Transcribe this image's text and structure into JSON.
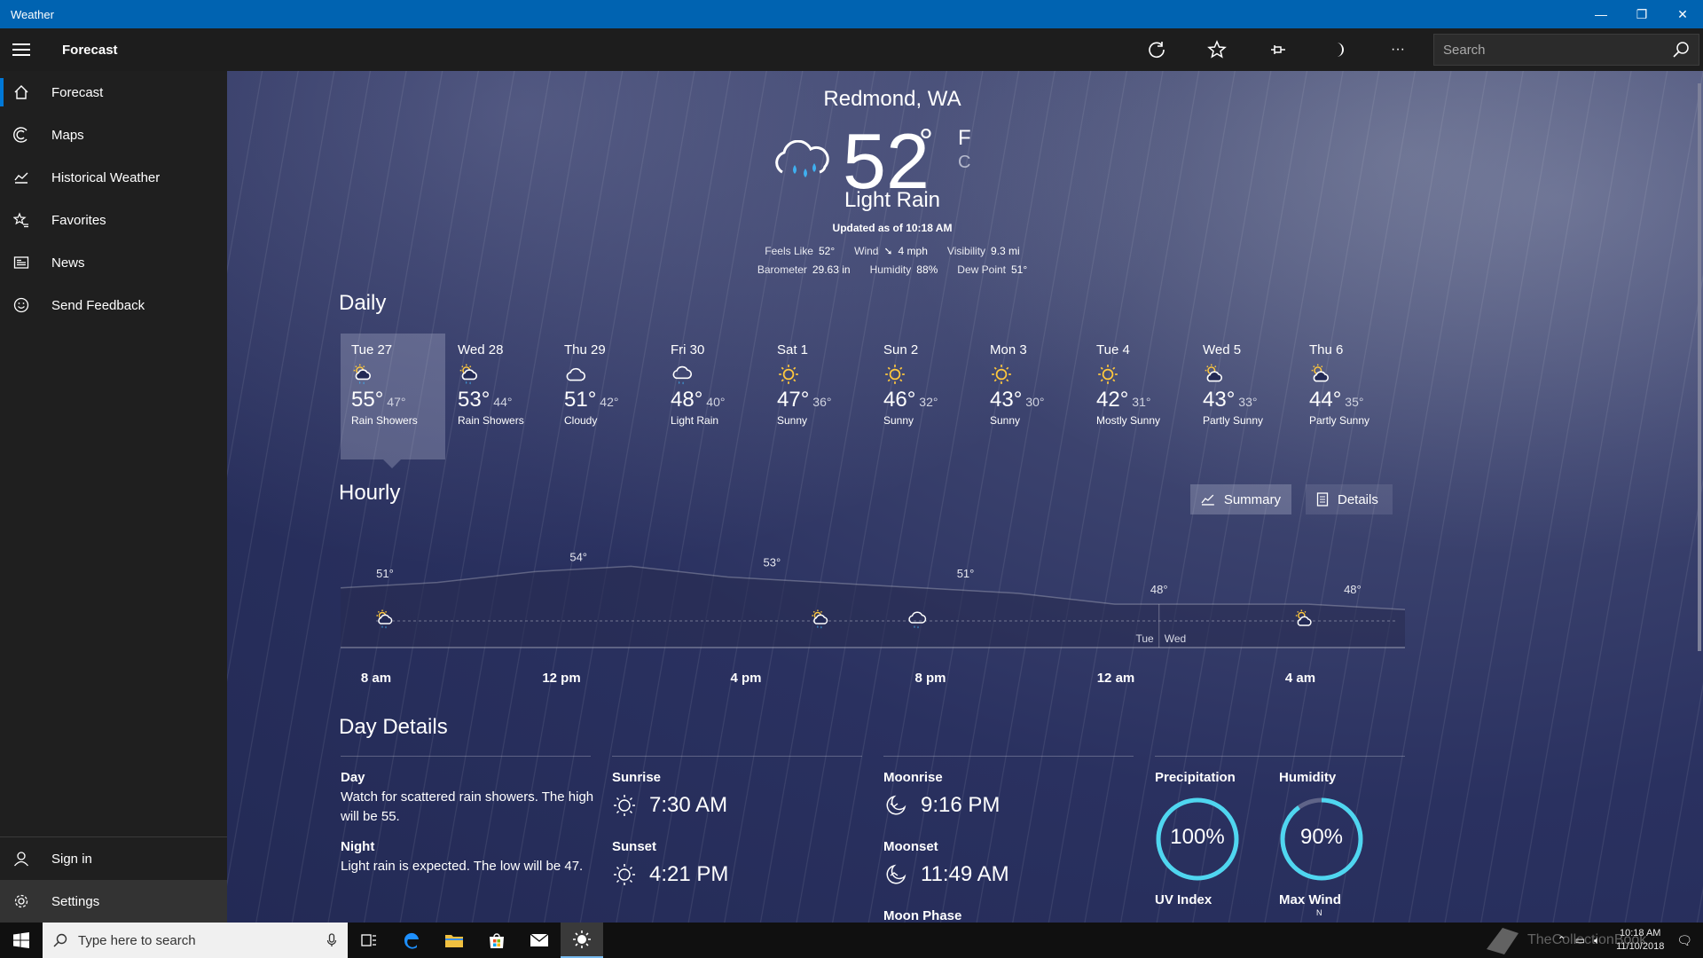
{
  "window": {
    "title": "Weather",
    "minimize": "—",
    "maximize": "❐",
    "close": "✕"
  },
  "appbar": {
    "page_title": "Forecast",
    "search_placeholder": "Search",
    "more": "···"
  },
  "sidebar": {
    "items": [
      {
        "label": "Forecast",
        "icon": "home-icon"
      },
      {
        "label": "Maps",
        "icon": "maps-icon"
      },
      {
        "label": "Historical Weather",
        "icon": "chart-icon"
      },
      {
        "label": "Favorites",
        "icon": "star-list-icon"
      },
      {
        "label": "News",
        "icon": "news-icon"
      },
      {
        "label": "Send Feedback",
        "icon": "smiley-icon"
      }
    ],
    "bottom": [
      {
        "label": "Sign in",
        "icon": "person-icon"
      },
      {
        "label": "Settings",
        "icon": "gear-icon"
      }
    ]
  },
  "current": {
    "location": "Redmond, WA",
    "temp": "52",
    "degree": "°",
    "unit_f": "F",
    "unit_c": "C",
    "condition": "Light Rain",
    "updated": "Updated as of 10:18 AM",
    "feels_like_label": "Feels Like",
    "feels_like": "52°",
    "wind_label": "Wind",
    "wind": "4 mph",
    "visibility_label": "Visibility",
    "visibility": "9.3 mi",
    "barometer_label": "Barometer",
    "barometer": "29.63 in",
    "humidity_label": "Humidity",
    "humidity": "88%",
    "dew_label": "Dew Point",
    "dew": "51°"
  },
  "daily": {
    "title": "Daily",
    "days": [
      {
        "name": "Tue 27",
        "hi": "55°",
        "lo": "47°",
        "cond": "Rain Showers",
        "icon": "rain-sun-icon"
      },
      {
        "name": "Wed 28",
        "hi": "53°",
        "lo": "44°",
        "cond": "Rain Showers",
        "icon": "rain-sun-icon"
      },
      {
        "name": "Thu 29",
        "hi": "51°",
        "lo": "42°",
        "cond": "Cloudy",
        "icon": "cloud-icon"
      },
      {
        "name": "Fri 30",
        "hi": "48°",
        "lo": "40°",
        "cond": "Light Rain",
        "icon": "rain-icon"
      },
      {
        "name": "Sat 1",
        "hi": "47°",
        "lo": "36°",
        "cond": "Sunny",
        "icon": "sun-icon"
      },
      {
        "name": "Sun 2",
        "hi": "46°",
        "lo": "32°",
        "cond": "Sunny",
        "icon": "sun-icon"
      },
      {
        "name": "Mon 3",
        "hi": "43°",
        "lo": "30°",
        "cond": "Sunny",
        "icon": "sun-icon"
      },
      {
        "name": "Tue 4",
        "hi": "42°",
        "lo": "31°",
        "cond": "Mostly Sunny",
        "icon": "sun-icon"
      },
      {
        "name": "Wed 5",
        "hi": "43°",
        "lo": "33°",
        "cond": "Partly Sunny",
        "icon": "partly-sunny-icon"
      },
      {
        "name": "Thu 6",
        "hi": "44°",
        "lo": "35°",
        "cond": "Partly Sunny",
        "icon": "partly-sunny-icon"
      }
    ]
  },
  "hourly": {
    "title": "Hourly",
    "summary_label": "Summary",
    "details_label": "Details",
    "labels": [
      "8 am",
      "12 pm",
      "4 pm",
      "8 pm",
      "12 am",
      "4 am"
    ],
    "day_divider": [
      "Tue",
      "Wed"
    ]
  },
  "chart_data": {
    "type": "area",
    "x": [
      "8 am",
      "10 am",
      "12 pm",
      "2 pm",
      "4 pm",
      "6 pm",
      "8 pm",
      "10 pm",
      "12 am",
      "2 am",
      "4 am",
      "6 am"
    ],
    "values": [
      51,
      52,
      54,
      55,
      53,
      52,
      51,
      50,
      48,
      48,
      48,
      47
    ],
    "point_labels": [
      "51°",
      "54°",
      "53°",
      "51°",
      "48°",
      "48°"
    ],
    "point_label_x": [
      "8 am",
      "12 pm",
      "4 pm",
      "8 pm",
      "12 am",
      "4 am"
    ],
    "point_label_values": [
      51,
      54,
      53,
      51,
      48,
      48
    ],
    "icons": [
      {
        "x": "8 am",
        "icon": "rain-sun-icon"
      },
      {
        "x": "5 pm",
        "icon": "rain-sun-icon"
      },
      {
        "x": "7 pm",
        "icon": "rain-icon"
      },
      {
        "x": "3 am",
        "icon": "partly-sunny-icon"
      }
    ]
  },
  "day_details": {
    "title": "Day Details",
    "day_label": "Day",
    "day_text": "Watch for scattered rain showers. The high will be 55.",
    "night_label": "Night",
    "night_text": "Light rain is expected. The low will be 47.",
    "sunrise_label": "Sunrise",
    "sunrise": "7:30 AM",
    "sunset_label": "Sunset",
    "sunset": "4:21 PM",
    "moonrise_label": "Moonrise",
    "moonrise": "9:16 PM",
    "moonset_label": "Moonset",
    "moonset": "11:49 AM",
    "moonphase_label": "Moon Phase",
    "precip_label": "Precipitation",
    "precip": "100%",
    "precip_fraction": 1.0,
    "humidity_label": "Humidity",
    "humidity": "90%",
    "humidity_fraction": 0.9,
    "uv_label": "UV Index",
    "wind_label": "Max Wind",
    "wind_dir": "N"
  },
  "taskbar": {
    "search_placeholder": "Type here to search",
    "time": "10:18 AM",
    "date": "11/10/2018",
    "watermark": "TheCollectionBook"
  },
  "colors": {
    "accent": "#0078d7",
    "gauge": "#4fd6f0",
    "titlebar": "#0063b1"
  }
}
